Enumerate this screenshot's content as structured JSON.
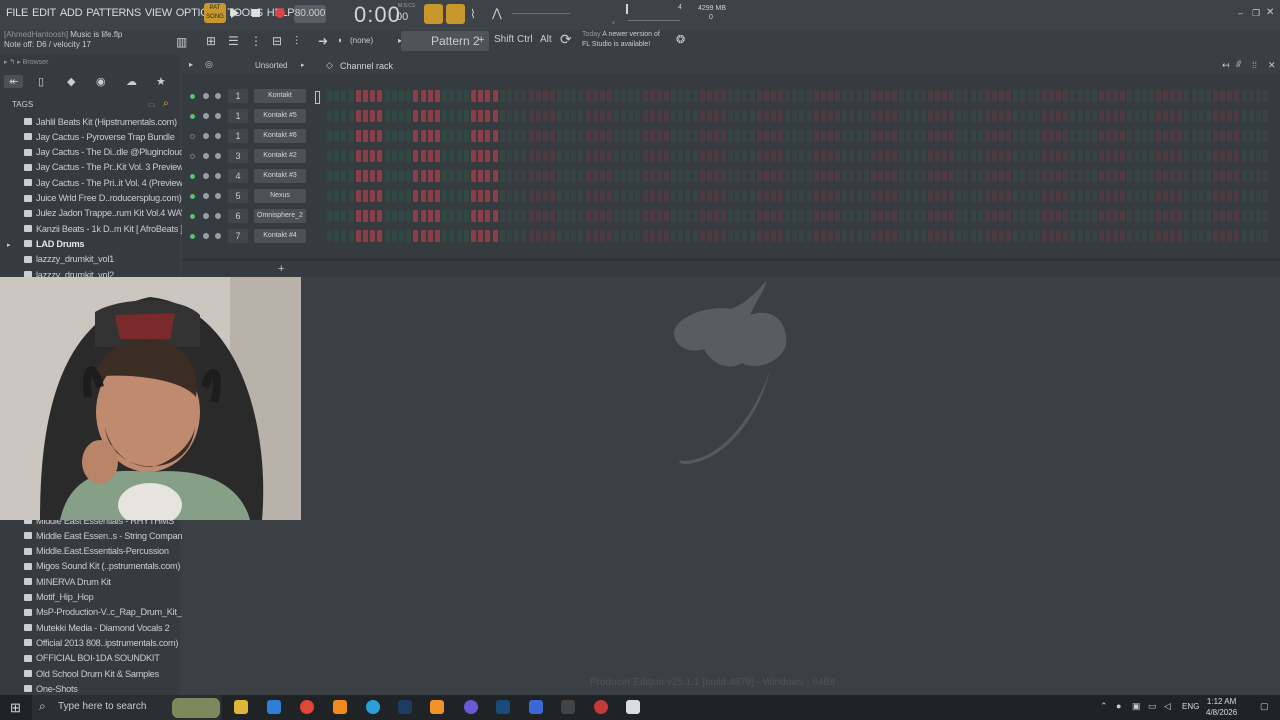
{
  "menu": [
    "FILE",
    "EDIT",
    "ADD",
    "PATTERNS",
    "VIEW",
    "OPTIONS",
    "TOOLS",
    "HELP"
  ],
  "transport": {
    "pat_label": "PAT",
    "song_label": "SONG",
    "tempo": "80.000",
    "time_main": "0:00",
    "time_sub": "00",
    "time_unit": "M:S:CS"
  },
  "hint": {
    "user": "[AhmedHantoosh]",
    "project": "Music is life.flp",
    "note": "Note off: D6 / velocity 17"
  },
  "toolbar": {
    "none_label": "(none)",
    "pattern": "Pattern 2",
    "shift": "Shift",
    "ctrl": "Ctrl",
    "alt": "Alt"
  },
  "news": {
    "today": "Today",
    "line1": "A newer version of",
    "line2": "FL Studio is available!"
  },
  "memory": {
    "mb": "4299 MB",
    "cpu": "4",
    "voices": "0"
  },
  "browser": {
    "title": "Browser",
    "tags": "TAGS",
    "folders_top": [
      "Jahlil Beats Kit (Hipstrumentals.com)",
      "Jay Cactus - Pyroverse Trap Bundle",
      "Jay Cactus - The Di..dle @Pluginclouds",
      "Jay Cactus - The Pr..Kit Vol. 3 Preview",
      "Jay Cactus - The Pri..it Vol. 4 (Preview)",
      "Juice Wrld Free D..roducersplug.com)",
      "Julez Jadon Trappe..rum Kit Vol.4 WAV",
      "Kanzii Beats - 1k D..m Kit [ AfroBeats ]",
      "LAD Drums",
      "lazzzy_drumkit_vol1",
      "lazzzy_drumkit_vol2"
    ],
    "folders_bottom": [
      "Middle East Essentials - RHYTHMS",
      "Middle East Essen..s - String Company",
      "Middle.East.Essentials-Percussion",
      "Migos Sound Kit (..pstrumentals.com)",
      "MINERVA Drum Kit",
      "Motif_Hip_Hop",
      "MsP-Production-V..c_Rap_Drum_Kit_3",
      "Mutekki Media - Diamond Vocals 2",
      "Official 2013 808..ipstrumentals.com)",
      "OFFICIAL BOI-1DA SOUNDKIT",
      "Old School Drum Kit & Samples",
      "One-Shots"
    ]
  },
  "rack": {
    "filter": "Unsorted",
    "title": "Channel rack",
    "channels": [
      {
        "num": "1",
        "name": "Kontakt",
        "on": true
      },
      {
        "num": "1",
        "name": "Kontakt #5",
        "on": true
      },
      {
        "num": "1",
        "name": "Kontakt #6",
        "on": false
      },
      {
        "num": "3",
        "name": "Kontakt #2",
        "on": false
      },
      {
        "num": "4",
        "name": "Kontakt #3",
        "on": true
      },
      {
        "num": "5",
        "name": "Nexus",
        "on": true
      },
      {
        "num": "6",
        "name": "Omnisphere_2",
        "on": true
      },
      {
        "num": "7",
        "name": "Kontakt #4",
        "on": true
      }
    ]
  },
  "edition": "Producer Edition v25.1.1 [build 4879] - Windows - 64Bit",
  "taskbar": {
    "search": "Type here to search",
    "lang": "ENG",
    "time": "1:12 AM",
    "date": "4/8/2026"
  },
  "colors": {
    "accent_orange": "#c9982c",
    "step_red": "#8c3e48",
    "step_dark": "#2f4a42",
    "led_green": "#55c36a",
    "record_red": "#d9444a"
  }
}
